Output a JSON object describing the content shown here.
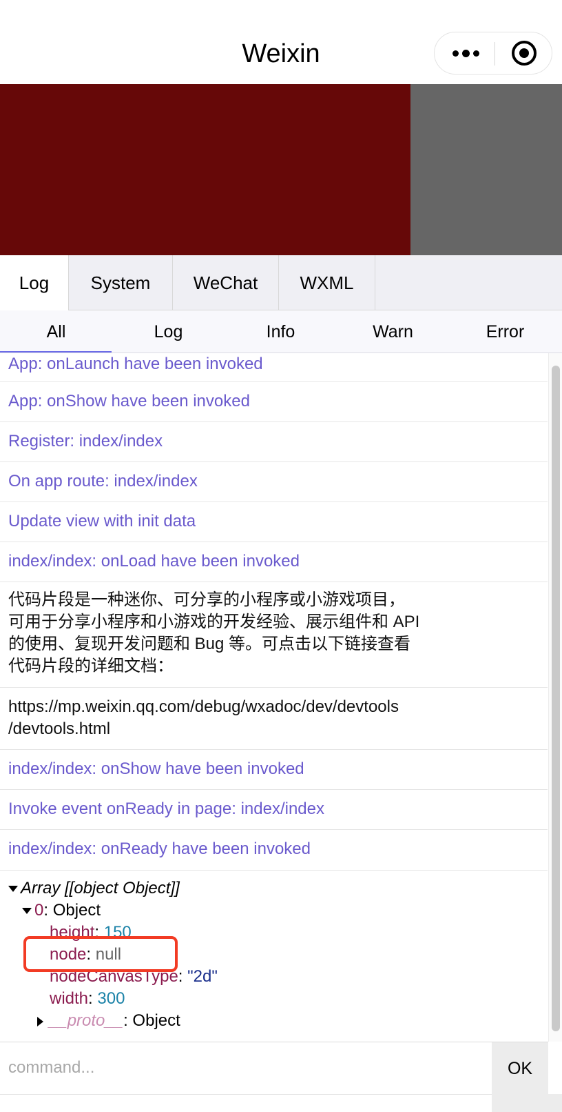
{
  "nav": {
    "title": "Weixin"
  },
  "colors": {
    "canvas_red": "#660808",
    "canvas_gray": "#666666",
    "log_text": "#6a5acd",
    "highlight": "#f23b24"
  },
  "tabs": [
    {
      "label": "Log"
    },
    {
      "label": "System"
    },
    {
      "label": "WeChat"
    },
    {
      "label": "WXML"
    }
  ],
  "filters": [
    {
      "label": "All"
    },
    {
      "label": "Log"
    },
    {
      "label": "Info"
    },
    {
      "label": "Warn"
    },
    {
      "label": "Error"
    }
  ],
  "logs": [
    "App: onLaunch have been invoked",
    "App: onShow have been invoked",
    "Register: index/index",
    "On app route: index/index",
    "Update view with init data",
    "index/index: onLoad have been invoked",
    "代码片段是一种迷你、可分享的小程序或小游戏项目，",
    "可用于分享小程序和小游戏的开发经验、展示组件和 API",
    "的使用、复现开发问题和 Bug 等。可点击以下链接查看",
    "代码片段的详细文档：",
    "https://mp.weixin.qq.com/debug/wxadoc/dev/devtools",
    "/devtools.html",
    "index/index: onShow have been invoked",
    "Invoke event onReady in page: index/index",
    "index/index: onReady have been invoked"
  ],
  "tree": {
    "root": "Array [[object Object]]",
    "item_key": "0",
    "item_type": ": Object",
    "height_key": "height",
    "height_val": "150",
    "node_key": "node",
    "node_val": "null",
    "type_key": "nodeCanvasType",
    "type_val": "\"2d\"",
    "width_key": "width",
    "width_val": "300",
    "proto_key": "__proto__",
    "proto_type": ": Object"
  },
  "command": {
    "placeholder": "command...",
    "ok_label": "OK"
  }
}
